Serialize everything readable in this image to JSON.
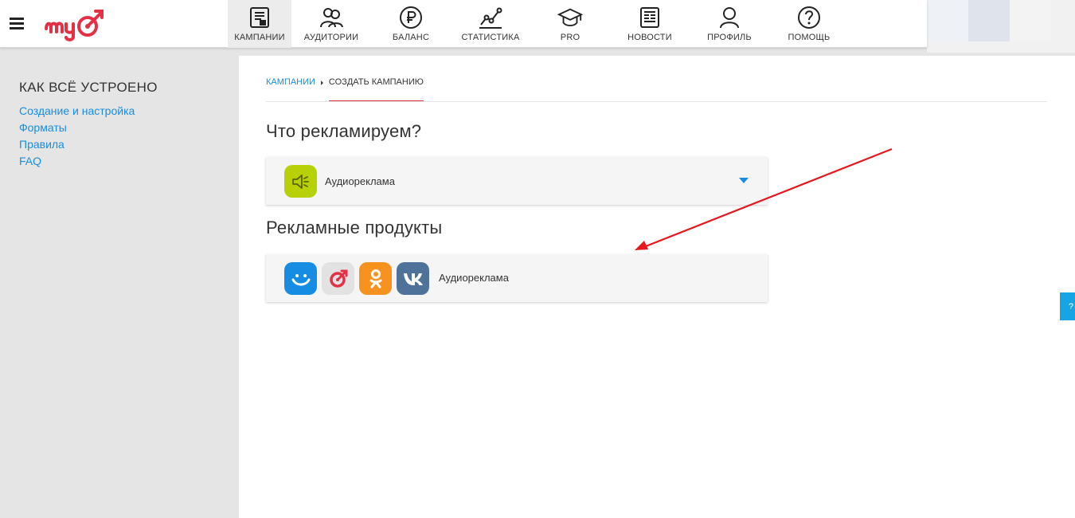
{
  "header": {
    "nav": [
      {
        "label": "КАМПАНИИ",
        "icon": "campaigns-icon",
        "active": true
      },
      {
        "label": "АУДИТОРИИ",
        "icon": "audiences-icon"
      },
      {
        "label": "БАЛАНС",
        "icon": "ruble-icon"
      },
      {
        "label": "СТАТИСТИКА",
        "icon": "statistics-icon"
      },
      {
        "label": "PRO",
        "icon": "graduation-cap-icon"
      },
      {
        "label": "НОВОСТИ",
        "icon": "news-icon"
      },
      {
        "label": "ПРОФИЛЬ",
        "icon": "profile-icon"
      },
      {
        "label": "ПОМОЩЬ",
        "icon": "help-icon"
      }
    ]
  },
  "sidebar": {
    "title": "КАК ВСЁ УСТРОЕНО",
    "links": [
      "Создание и настройка",
      "Форматы",
      "Правила",
      "FAQ"
    ]
  },
  "breadcrumb": {
    "parent": "КАМПАНИИ",
    "current": "СОЗДАТЬ КАМПАНИЮ"
  },
  "main": {
    "what_title": "Что рекламируем?",
    "selected_type": "Аудиореклама",
    "products_title": "Рекламные продукты",
    "product_label": "Аудиореклама"
  },
  "side_tab": {
    "label": "?"
  },
  "colors": {
    "accent_blue": "#168de2",
    "brand_red": "#e33044",
    "audio_green": "#b7d007",
    "annotation_arrow": "#e8161d"
  }
}
